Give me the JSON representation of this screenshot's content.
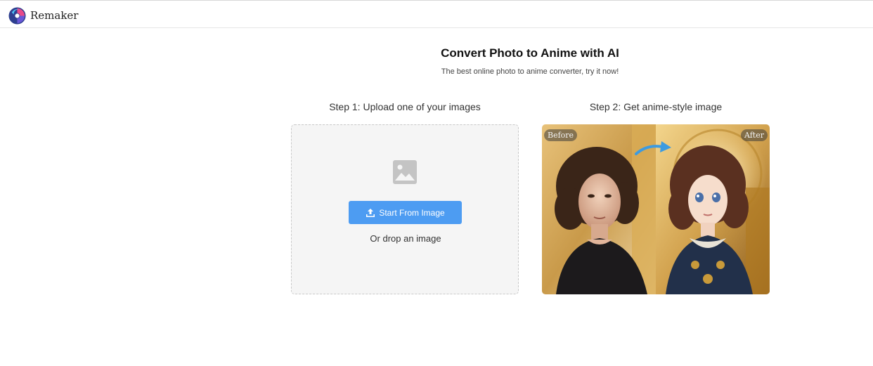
{
  "header": {
    "brand": "Remaker",
    "logo_icon": "remaker-logo-icon"
  },
  "hero": {
    "title": "Convert Photo to Anime with AI",
    "subtitle": "The best online photo to anime converter, try it now!"
  },
  "step1": {
    "label": "Step 1:  Upload one of your images",
    "icon": "image-icon",
    "button_icon": "upload-icon",
    "button_label": "Start From Image",
    "drop_text": "Or drop an image"
  },
  "step2": {
    "label": "Step 2:  Get anime-style image",
    "before_label": "Before",
    "after_label": "After"
  },
  "colors": {
    "accent": "#4d9cf2",
    "dropzone_bg": "#f5f5f5",
    "arrow": "#3d9be0"
  }
}
